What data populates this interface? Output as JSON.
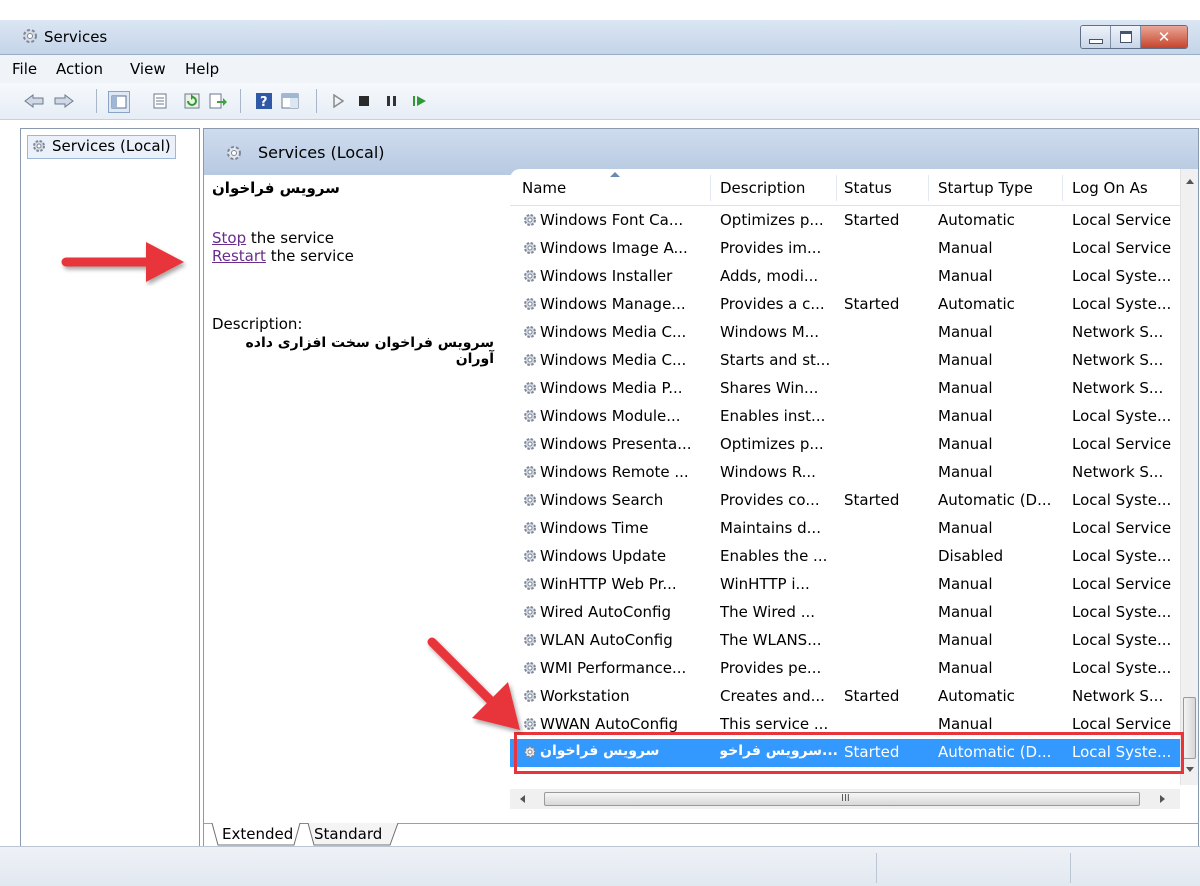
{
  "window": {
    "title": "Services"
  },
  "menu": [
    "File",
    "Action",
    "View",
    "Help"
  ],
  "toolbar": {
    "icons": [
      "back-icon",
      "forward-icon",
      "show-hide-tree-icon",
      "properties-icon",
      "refresh-icon",
      "export-list-icon",
      "help-icon",
      "action-pane-icon",
      "start-service-icon",
      "stop-service-icon",
      "pause-service-icon",
      "resume-service-icon"
    ]
  },
  "tree": {
    "root_label": "Services (Local)"
  },
  "pane": {
    "header_title": "Services (Local)"
  },
  "details": {
    "service_name": "سرویس فراخوان",
    "stop_link": "Stop",
    "stop_suffix": " the service",
    "restart_link": "Restart",
    "restart_suffix": " the service",
    "description_label": "Description:",
    "description_text": "سرویس فراخوان سخت افزاری داده آوران"
  },
  "columns": [
    "Name",
    "Description",
    "Status",
    "Startup Type",
    "Log On As"
  ],
  "services": [
    [
      "Windows Font Ca...",
      "Optimizes p...",
      "Started",
      "Automatic",
      "Local Service"
    ],
    [
      "Windows Image A...",
      "Provides im...",
      "",
      "Manual",
      "Local Service"
    ],
    [
      "Windows Installer",
      "Adds, modi...",
      "",
      "Manual",
      "Local Syste..."
    ],
    [
      "Windows Manage...",
      "Provides a c...",
      "Started",
      "Automatic",
      "Local Syste..."
    ],
    [
      "Windows Media C...",
      "Windows M...",
      "",
      "Manual",
      "Network S..."
    ],
    [
      "Windows Media C...",
      "Starts and st...",
      "",
      "Manual",
      "Network S..."
    ],
    [
      "Windows Media P...",
      "Shares Win...",
      "",
      "Manual",
      "Network S..."
    ],
    [
      "Windows Module...",
      "Enables inst...",
      "",
      "Manual",
      "Local Syste..."
    ],
    [
      "Windows Presenta...",
      "Optimizes p...",
      "",
      "Manual",
      "Local Service"
    ],
    [
      "Windows Remote ...",
      "Windows R...",
      "",
      "Manual",
      "Network S..."
    ],
    [
      "Windows Search",
      "Provides co...",
      "Started",
      "Automatic (D...",
      "Local Syste..."
    ],
    [
      "Windows Time",
      "Maintains d...",
      "",
      "Manual",
      "Local Service"
    ],
    [
      "Windows Update",
      "Enables the ...",
      "",
      "Disabled",
      "Local Syste..."
    ],
    [
      "WinHTTP Web Pr...",
      "WinHTTP i...",
      "",
      "Manual",
      "Local Service"
    ],
    [
      "Wired AutoConfig",
      "The Wired ...",
      "",
      "Manual",
      "Local Syste..."
    ],
    [
      "WLAN AutoConfig",
      "The WLANS...",
      "",
      "Manual",
      "Local Syste..."
    ],
    [
      "WMI Performance...",
      "Provides pe...",
      "",
      "Manual",
      "Local Syste..."
    ],
    [
      "Workstation",
      "Creates and...",
      "Started",
      "Automatic",
      "Network S..."
    ],
    [
      "WWAN AutoConfig",
      "This service ...",
      "",
      "Manual",
      "Local Service"
    ],
    [
      "سرویس فراخوان",
      "...سرویس فراخوا",
      "Started",
      "Automatic (D...",
      "Local Syste..."
    ]
  ],
  "selected_index": 19,
  "scrollbar": {
    "grip": "III"
  },
  "tabs": [
    "Extended",
    "Standard"
  ],
  "colors": {
    "selection": "#3399ff",
    "annotation_red": "#e8343a",
    "link": "#6a2d8d"
  }
}
